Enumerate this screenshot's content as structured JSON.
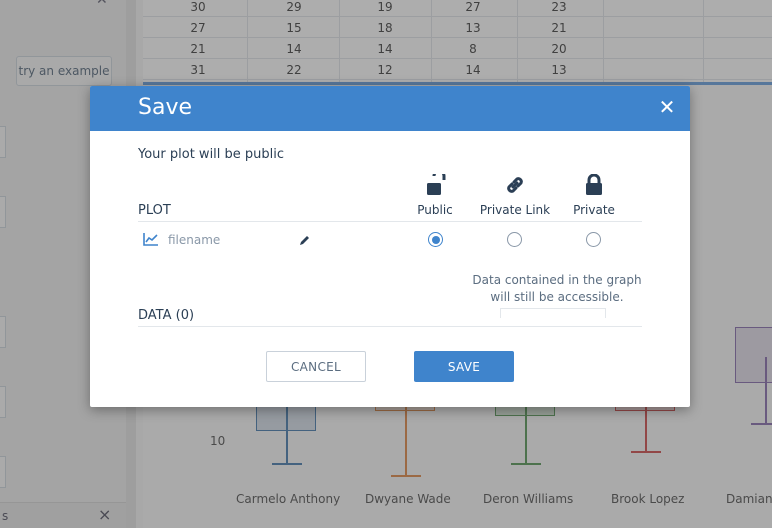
{
  "sidebar": {
    "try_example_label": "try an example",
    "footer_text": "s",
    "close_icon": "×"
  },
  "grid": {
    "rows": [
      [
        "30",
        "29",
        "19",
        "27",
        "23"
      ],
      [
        "27",
        "15",
        "18",
        "13",
        "21"
      ],
      [
        "21",
        "14",
        "14",
        "8",
        "20"
      ],
      [
        "31",
        "22",
        "12",
        "14",
        "13"
      ]
    ]
  },
  "chart": {
    "tick_label": "10",
    "x_labels": [
      "Carmelo Anthony",
      "Dwyane Wade",
      "Deron Williams",
      "Brook Lopez",
      "Damian"
    ],
    "colors": [
      "#4a7fb0",
      "#e08a4a",
      "#5a9a5a",
      "#d05050",
      "#8a70b0"
    ]
  },
  "modal": {
    "title": "Save",
    "close_icon": "close-icon",
    "public_message": "Your plot will be public",
    "plot_section_label": "PLOT",
    "data_section_label": "DATA (0)",
    "permissions": [
      {
        "label": "Public",
        "icon": "unlock-icon",
        "selected": true
      },
      {
        "label": "Private Link",
        "icon": "link-icon",
        "selected": false
      },
      {
        "label": "Private",
        "icon": "lock-icon",
        "selected": false
      }
    ],
    "file": {
      "icon": "line-chart-icon",
      "name_placeholder": "filename"
    },
    "note": "Data contained in the graph will still be accessible.",
    "cancel_label": "CANCEL",
    "save_label": "SAVE",
    "accent_color": "#3f84cc"
  }
}
